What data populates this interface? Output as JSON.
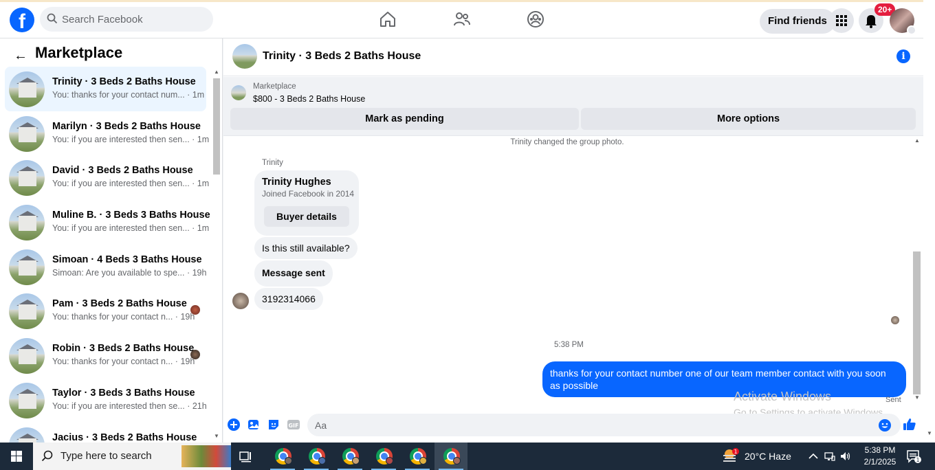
{
  "topbar": {
    "logo": "f",
    "search_placeholder": "Search Facebook",
    "find_friends": "Find friends",
    "notifications_badge": "20+"
  },
  "sidebar": {
    "title": "Marketplace",
    "conversations": [
      {
        "name": "Trinity · 3 Beds 2 Baths House",
        "snippet": "You: thanks for your contact num... · 1m",
        "active": true
      },
      {
        "name": "Marilyn · 3 Beds 2 Baths House",
        "snippet": "You: if you are interested then sen... · 1m"
      },
      {
        "name": "David · 3 Beds 2 Baths House",
        "snippet": "You: if you are interested then sen... · 1m"
      },
      {
        "name": "Muline B. · 3 Beds 3 Baths House",
        "snippet": "You: if you are interested then sen... · 1m"
      },
      {
        "name": "Simoan · 4 Beds 3 Baths House",
        "snippet": "Simoan: Are you available to spe... · 19h"
      },
      {
        "name": "Pam · 3 Beds 2 Baths House",
        "snippet": "You: thanks for your contact n... · 19h",
        "seen_avatar": true
      },
      {
        "name": "Robin · 3 Beds 2 Baths House",
        "snippet": "You: thanks for your contact n... · 19h",
        "seen_avatar": true
      },
      {
        "name": "Taylor · 3 Beds 3 Baths House",
        "snippet": "You: if you are interested then se... · 21h"
      },
      {
        "name": "Jacius · 3 Beds 2 Baths House",
        "snippet": ""
      }
    ]
  },
  "chat": {
    "title": "Trinity · 3 Beds 2 Baths House",
    "listing_label": "Marketplace",
    "listing_price": "$800 - 3 Beds 2 Baths House",
    "mark_pending": "Mark as pending",
    "more_options": "More options",
    "system_message": "Trinity changed the group photo.",
    "sender_label": "Trinity",
    "buyer_name": "Trinity Hughes",
    "buyer_joined": "Joined Facebook in 2014",
    "buyer_details": "Buyer details",
    "incoming": [
      "Is this still available?",
      "Message sent",
      "3192314066"
    ],
    "timestamp": "5:38 PM",
    "outgoing": "thanks for your contact number one of our team member contact with you soon as possible",
    "status": "Sent",
    "composer_placeholder": "Aa"
  },
  "watermark": {
    "line1": "Activate Windows",
    "line2": "Go to Settings to activate Windows."
  },
  "taskbar": {
    "search_placeholder": "Type here to search",
    "weather": "20°C  Haze",
    "weather_badge": "1",
    "time": "5:38 PM",
    "date": "2/1/2025",
    "notification_count": "1"
  }
}
